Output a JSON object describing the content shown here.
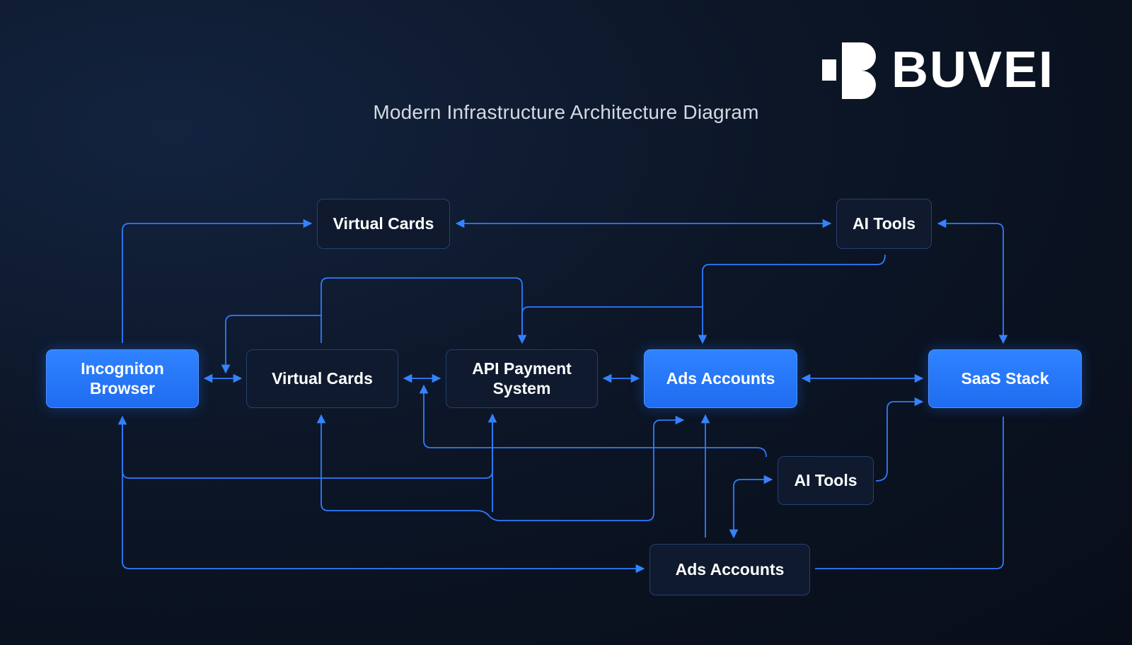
{
  "brand": {
    "name": "BUVEI"
  },
  "title": "Modern Infrastructure Architecture Diagram",
  "colors": {
    "background": "#0b1424",
    "accent": "#2a78ff",
    "node_dark": "#0f1a2e",
    "connector": "#2f7bff"
  },
  "nodes": {
    "virtual_cards_top": "Virtual Cards",
    "ai_tools_top": "AI Tools",
    "incognito_browser": "Incogniton Browser",
    "virtual_cards_mid": "Virtual Cards",
    "api_payment": "API Payment System",
    "ads_accounts_mid": "Ads Accounts",
    "saas_stack": "SaaS Stack",
    "ai_tools_bottom": "AI Tools",
    "ads_accounts_bottom": "Ads Accounts"
  }
}
